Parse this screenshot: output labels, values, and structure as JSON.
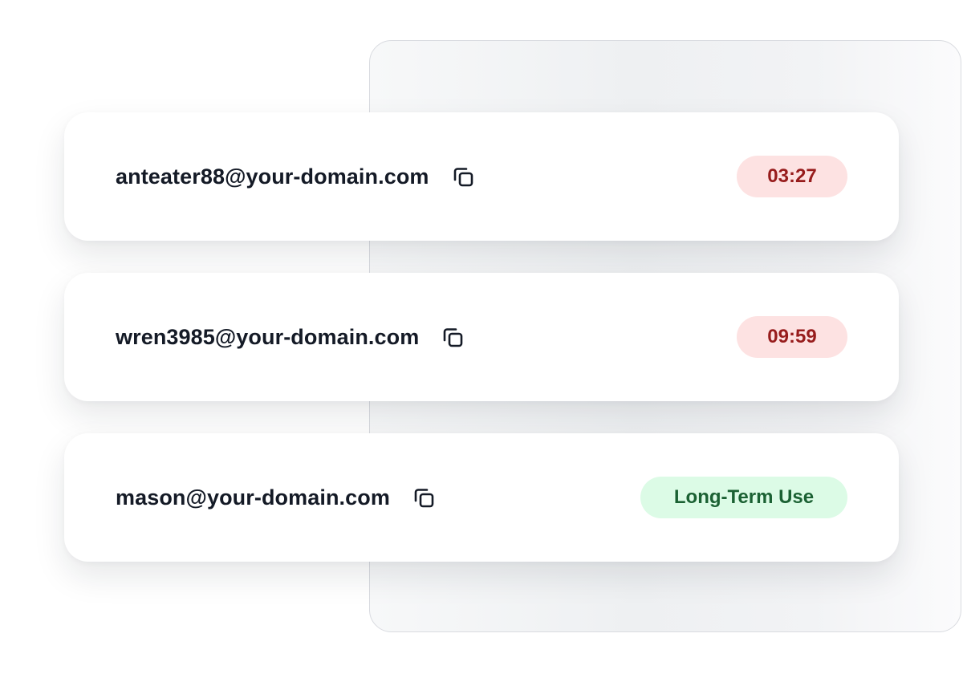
{
  "colors": {
    "timer_badge_bg": "#fde2e2",
    "timer_badge_text": "#971c1c",
    "permanent_badge_bg": "#dcfbe6",
    "permanent_badge_text": "#1b6133",
    "email_text": "#141a26"
  },
  "emails": [
    {
      "address": "anteater88@your-domain.com",
      "status": "03:27",
      "status_kind": "timer",
      "copy_icon": "copy-icon"
    },
    {
      "address": "wren3985@your-domain.com",
      "status": "09:59",
      "status_kind": "timer",
      "copy_icon": "copy-icon"
    },
    {
      "address": "mason@your-domain.com",
      "status": "Long-Term Use",
      "status_kind": "permanent",
      "copy_icon": "copy-icon"
    }
  ]
}
